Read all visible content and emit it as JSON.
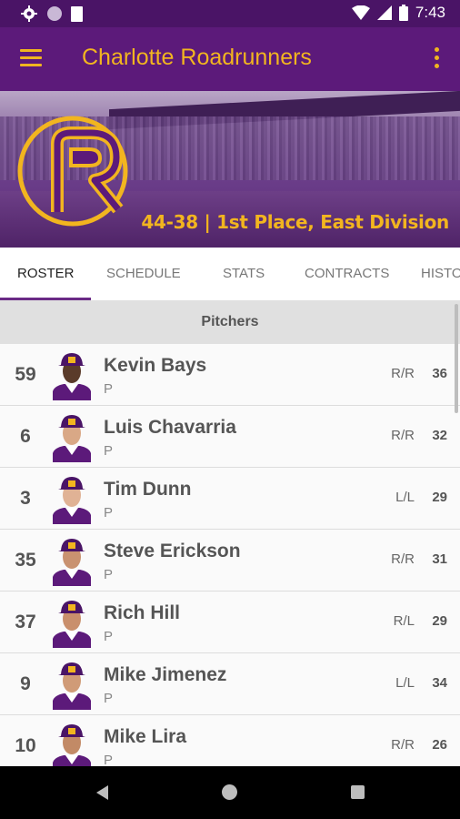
{
  "status": {
    "time": "7:43"
  },
  "appbar": {
    "title": "Charlotte Roadrunners"
  },
  "banner": {
    "record": "44-38 | 1st Place, East Division"
  },
  "colors": {
    "primary": "#5c1a7a",
    "accent": "#f2b51f"
  },
  "tabs": [
    {
      "label": "ROSTER",
      "active": true
    },
    {
      "label": "SCHEDULE"
    },
    {
      "label": "STATS"
    },
    {
      "label": "CONTRACTS"
    },
    {
      "label": "HISTO"
    }
  ],
  "section": {
    "title": "Pitchers"
  },
  "players": [
    {
      "number": "59",
      "name": "Kevin Bays",
      "position": "P",
      "bats_throws": "R/R",
      "age": "36"
    },
    {
      "number": "6",
      "name": "Luis Chavarria",
      "position": "P",
      "bats_throws": "R/R",
      "age": "32"
    },
    {
      "number": "3",
      "name": "Tim Dunn",
      "position": "P",
      "bats_throws": "L/L",
      "age": "29"
    },
    {
      "number": "35",
      "name": "Steve Erickson",
      "position": "P",
      "bats_throws": "R/R",
      "age": "31"
    },
    {
      "number": "37",
      "name": "Rich Hill",
      "position": "P",
      "bats_throws": "R/L",
      "age": "29"
    },
    {
      "number": "9",
      "name": "Mike Jimenez",
      "position": "P",
      "bats_throws": "L/L",
      "age": "34"
    },
    {
      "number": "10",
      "name": "Mike Lira",
      "position": "P",
      "bats_throws": "R/R",
      "age": "26"
    }
  ]
}
